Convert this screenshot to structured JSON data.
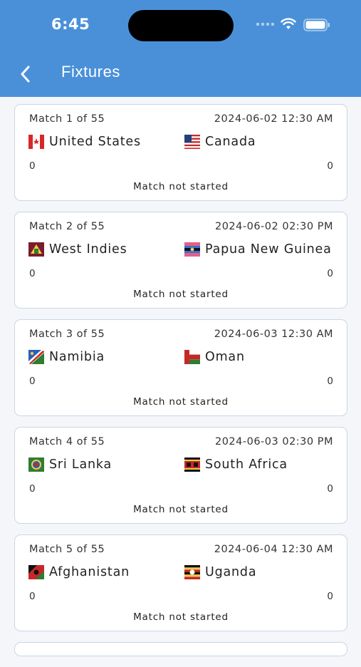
{
  "status_bar": {
    "time": "6:45"
  },
  "header": {
    "title": "Fixtures",
    "back_icon": "chevron-left-icon"
  },
  "colors": {
    "header_bg": "#4a90d9",
    "card_border": "#c9d7e8"
  },
  "matches": [
    {
      "match_label": "Match 1 of 55",
      "datetime": "2024-06-02 12:30 AM",
      "team1": {
        "name": "United States",
        "flag": "flag-icon"
      },
      "team2": {
        "name": "Canada",
        "flag": "flag-icon"
      },
      "score1": "0",
      "score2": "0",
      "status": "Match not started"
    },
    {
      "match_label": "Match 2 of 55",
      "datetime": "2024-06-02 02:30 PM",
      "team1": {
        "name": "West Indies",
        "flag": "flag-icon"
      },
      "team2": {
        "name": "Papua New Guinea",
        "flag": "flag-icon"
      },
      "score1": "0",
      "score2": "0",
      "status": "Match not started"
    },
    {
      "match_label": "Match 3 of 55",
      "datetime": "2024-06-03 12:30 AM",
      "team1": {
        "name": "Namibia",
        "flag": "flag-icon"
      },
      "team2": {
        "name": "Oman",
        "flag": "flag-icon"
      },
      "score1": "0",
      "score2": "0",
      "status": "Match not started"
    },
    {
      "match_label": "Match 4 of 55",
      "datetime": "2024-06-03 02:30 PM",
      "team1": {
        "name": "Sri Lanka",
        "flag": "flag-icon"
      },
      "team2": {
        "name": "South Africa",
        "flag": "flag-icon"
      },
      "score1": "0",
      "score2": "0",
      "status": "Match not started"
    },
    {
      "match_label": "Match 5 of 55",
      "datetime": "2024-06-04 12:30 AM",
      "team1": {
        "name": "Afghanistan",
        "flag": "flag-icon"
      },
      "team2": {
        "name": "Uganda",
        "flag": "flag-icon"
      },
      "score1": "0",
      "score2": "0",
      "status": "Match not started"
    }
  ]
}
